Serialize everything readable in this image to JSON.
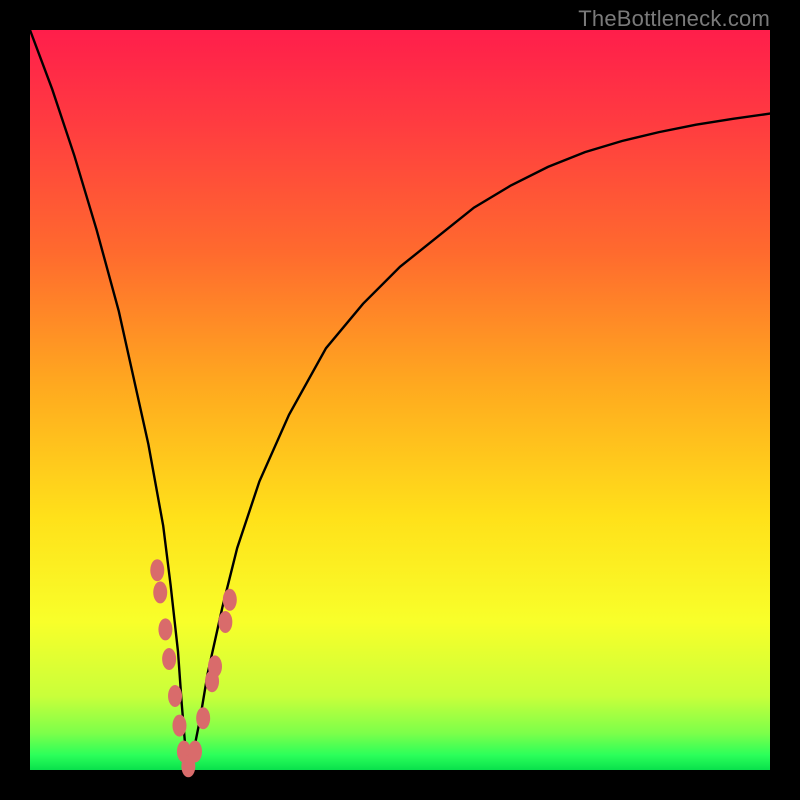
{
  "watermark": "TheBottleneck.com",
  "chart_data": {
    "type": "line",
    "title": "",
    "xlabel": "",
    "ylabel": "",
    "xlim": [
      0,
      100
    ],
    "ylim": [
      0,
      100
    ],
    "series": [
      {
        "name": "bottleneck-curve",
        "x": [
          0,
          3,
          6,
          9,
          12,
          14,
          16,
          18,
          19,
          20,
          20.5,
          21,
          21.5,
          22,
          23,
          24,
          26,
          28,
          31,
          35,
          40,
          45,
          50,
          55,
          60,
          65,
          70,
          75,
          80,
          85,
          90,
          95,
          100
        ],
        "values": [
          100,
          92,
          83,
          73,
          62,
          53,
          44,
          33,
          25,
          16,
          9,
          3,
          0,
          2,
          7,
          13,
          22,
          30,
          39,
          48,
          57,
          63,
          68,
          72,
          76,
          79,
          81.5,
          83.5,
          85,
          86.2,
          87.2,
          88,
          88.7
        ]
      }
    ],
    "markers": {
      "name": "highlight-dots",
      "color": "#d96b6b",
      "points": [
        {
          "x": 17.2,
          "y": 27
        },
        {
          "x": 17.6,
          "y": 24
        },
        {
          "x": 18.3,
          "y": 19
        },
        {
          "x": 18.8,
          "y": 15
        },
        {
          "x": 19.6,
          "y": 10
        },
        {
          "x": 20.2,
          "y": 6
        },
        {
          "x": 20.8,
          "y": 2.5
        },
        {
          "x": 21.4,
          "y": 0.5
        },
        {
          "x": 22.3,
          "y": 2.5
        },
        {
          "x": 23.4,
          "y": 7
        },
        {
          "x": 24.6,
          "y": 12
        },
        {
          "x": 25.0,
          "y": 14
        },
        {
          "x": 26.4,
          "y": 20
        },
        {
          "x": 27.0,
          "y": 23
        }
      ]
    }
  }
}
